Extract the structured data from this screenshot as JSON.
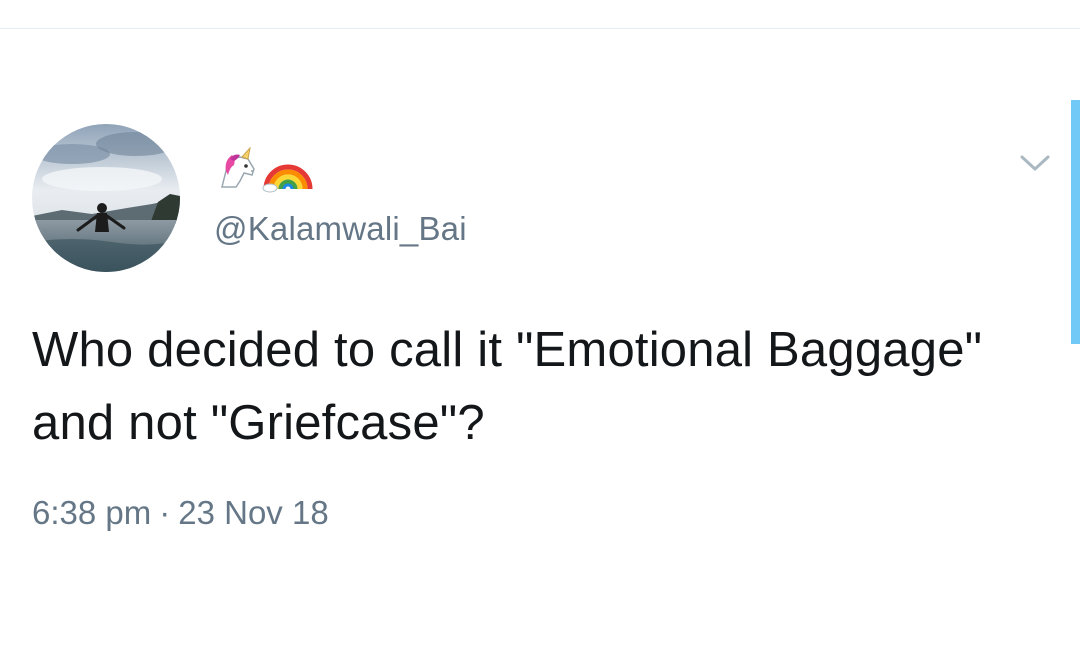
{
  "tweet": {
    "author": {
      "display_name_icons": [
        "unicorn-icon",
        "rainbow-icon"
      ],
      "handle": "@Kalamwali_Bai"
    },
    "text": "Who decided to call it \"Emotional Baggage\" and not \"Griefcase\"?",
    "time": "6:38 pm",
    "separator": "·",
    "date": "23 Nov 18",
    "menu_icon": "chevron-down-icon"
  },
  "colors": {
    "text_primary": "#14171a",
    "text_secondary": "#657786",
    "divider": "#e6ecf0",
    "scroll_indicator": "#71c9f8"
  }
}
